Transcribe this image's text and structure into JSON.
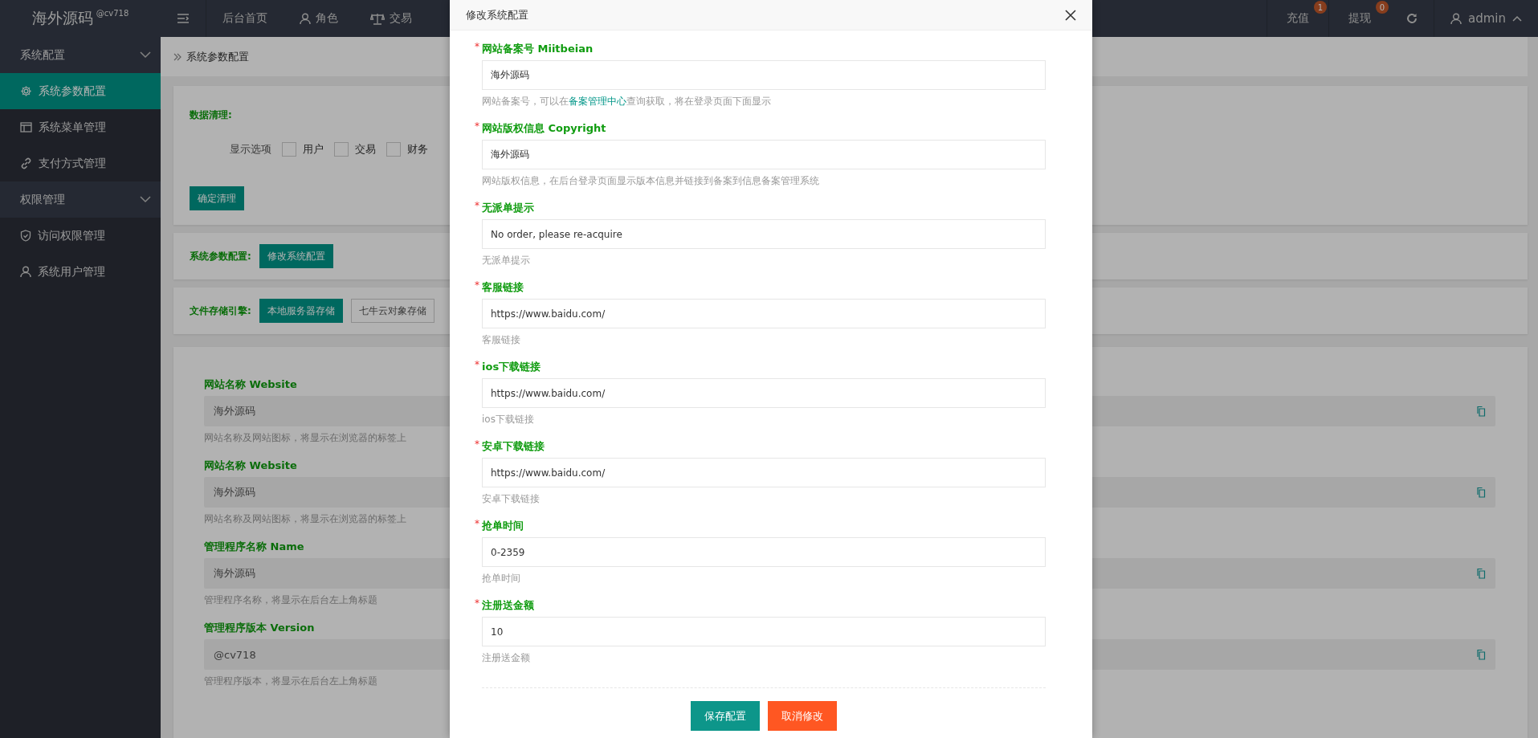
{
  "topbar": {
    "logo": "海外源码",
    "logo_tag": "@cv718",
    "nav": [
      {
        "label": "后台首页"
      },
      {
        "label": "角色"
      },
      {
        "label": "交易"
      }
    ],
    "right": [
      {
        "label": "充值",
        "badge": "1"
      },
      {
        "label": "提现",
        "badge": "0"
      }
    ],
    "user": "admin"
  },
  "sidebar": {
    "groups": [
      {
        "label": "系统配置",
        "expanded": true,
        "items": [
          {
            "label": "系统参数配置",
            "selected": true
          },
          {
            "label": "系统菜单管理",
            "selected": false
          },
          {
            "label": "支付方式管理",
            "selected": false
          }
        ]
      },
      {
        "label": "权限管理",
        "expanded": true,
        "items": [
          {
            "label": "访问权限管理",
            "selected": false
          },
          {
            "label": "系统用户管理",
            "selected": false
          }
        ]
      }
    ]
  },
  "breadcrumb": "系统参数配置",
  "cleanup": {
    "title": "数据清理:",
    "options_label": "显示选项",
    "options": [
      {
        "label": "用户",
        "checked": false
      },
      {
        "label": "交易",
        "checked": false
      },
      {
        "label": "财务",
        "checked": false
      }
    ],
    "button": "确定清理"
  },
  "params": {
    "title": "系统参数配置:",
    "button": "修改系统配置"
  },
  "storage": {
    "title": "文件存储引擎:",
    "engines": [
      {
        "label": "本地服务器存储",
        "selected": true
      },
      {
        "label": "七牛云对象存储",
        "selected": false
      }
    ]
  },
  "settings": [
    {
      "label": "网站名称 Website",
      "value": "海外源码",
      "hint": "网站名称及网站图标，将显示在浏览器的标签上"
    },
    {
      "label": "网站名称 Website",
      "value": "海外源码",
      "hint": "网站名称及网站图标，将显示在浏览器的标签上"
    },
    {
      "label": "管理程序名称 Name",
      "value": "海外源码",
      "hint": "管理程序名称，将显示在后台左上角标题"
    },
    {
      "label": "管理程序版本 Version",
      "value": "@cv718",
      "hint": "管理程序版本，将显示在后台左上角标题"
    }
  ],
  "modal": {
    "title": "修改系统配置",
    "fields": [
      {
        "label": "网站备案号 Miitbeian",
        "mark": "*",
        "value": "海外源码",
        "hint": "网站备案号，可以在",
        "hint_link": "备案管理中心",
        "hint_after": "查询获取，将在登录页面下面显示"
      },
      {
        "label": "网站版权信息 Copyright",
        "mark": "*",
        "value": "海外源码",
        "hint": "网站版权信息，在后台登录页面显示版本信息并链接到备案到信息备案管理系统"
      },
      {
        "label": "无派单提示",
        "mark": "*",
        "value": "No order, please re-acquire",
        "hint": "无派单提示"
      },
      {
        "label": "客服链接",
        "mark": "*",
        "value": "https://www.baidu.com/",
        "hint": "客服链接"
      },
      {
        "label": "ios下载链接",
        "mark": "*",
        "value": "https://www.baidu.com/",
        "hint": "ios下载链接"
      },
      {
        "label": "安卓下载链接",
        "mark": "*",
        "value": "https://www.baidu.com/",
        "hint": "安卓下载链接"
      },
      {
        "label": "抢单时间",
        "mark": "*",
        "value": "0-2359",
        "hint": "抢单时间"
      },
      {
        "label": "注册送金额",
        "mark": "*",
        "value": "10",
        "hint": "注册送金额"
      }
    ],
    "buttons": [
      {
        "label": "保存配置",
        "kind": "primary"
      },
      {
        "label": "取消修改",
        "kind": "danger"
      }
    ]
  }
}
